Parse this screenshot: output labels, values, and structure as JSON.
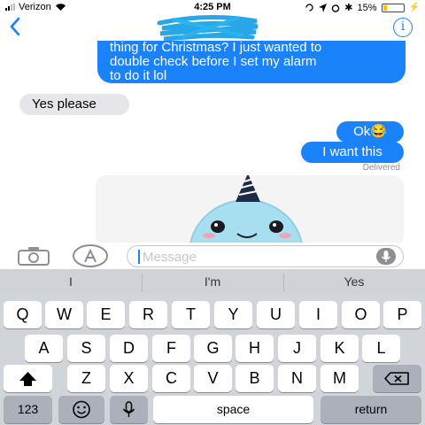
{
  "status_bar": {
    "carrier": "Verizon",
    "time": "4:25 PM",
    "battery": "15%"
  },
  "nav": {
    "back_icon": "chevron-left-icon",
    "info_label": "i"
  },
  "messages": [
    {
      "direction": "out",
      "text_lines": [
        "thing for Christmas? I just wanted to",
        "double check before I set my alarm",
        "to do it lol"
      ]
    },
    {
      "direction": "in",
      "text": "Yes please"
    },
    {
      "direction": "out",
      "text": "Ok😂"
    },
    {
      "direction": "out",
      "text": "I want this"
    }
  ],
  "delivered_label": "Delivered",
  "input": {
    "placeholder": "Message"
  },
  "suggestions": [
    "I",
    "I'm",
    "Yes"
  ],
  "keyboard": {
    "row1": [
      "Q",
      "W",
      "E",
      "R",
      "T",
      "Y",
      "U",
      "I",
      "O",
      "P"
    ],
    "row2": [
      "A",
      "S",
      "D",
      "F",
      "G",
      "H",
      "J",
      "K",
      "L"
    ],
    "row3": [
      "Z",
      "X",
      "C",
      "V",
      "B",
      "N",
      "M"
    ],
    "numbers_label": "123",
    "space_label": "space",
    "return_label": "return"
  },
  "colors": {
    "accent": "#1a82fb",
    "incoming_bubble": "#e5e5ea",
    "battery_low": "#f3c400"
  }
}
